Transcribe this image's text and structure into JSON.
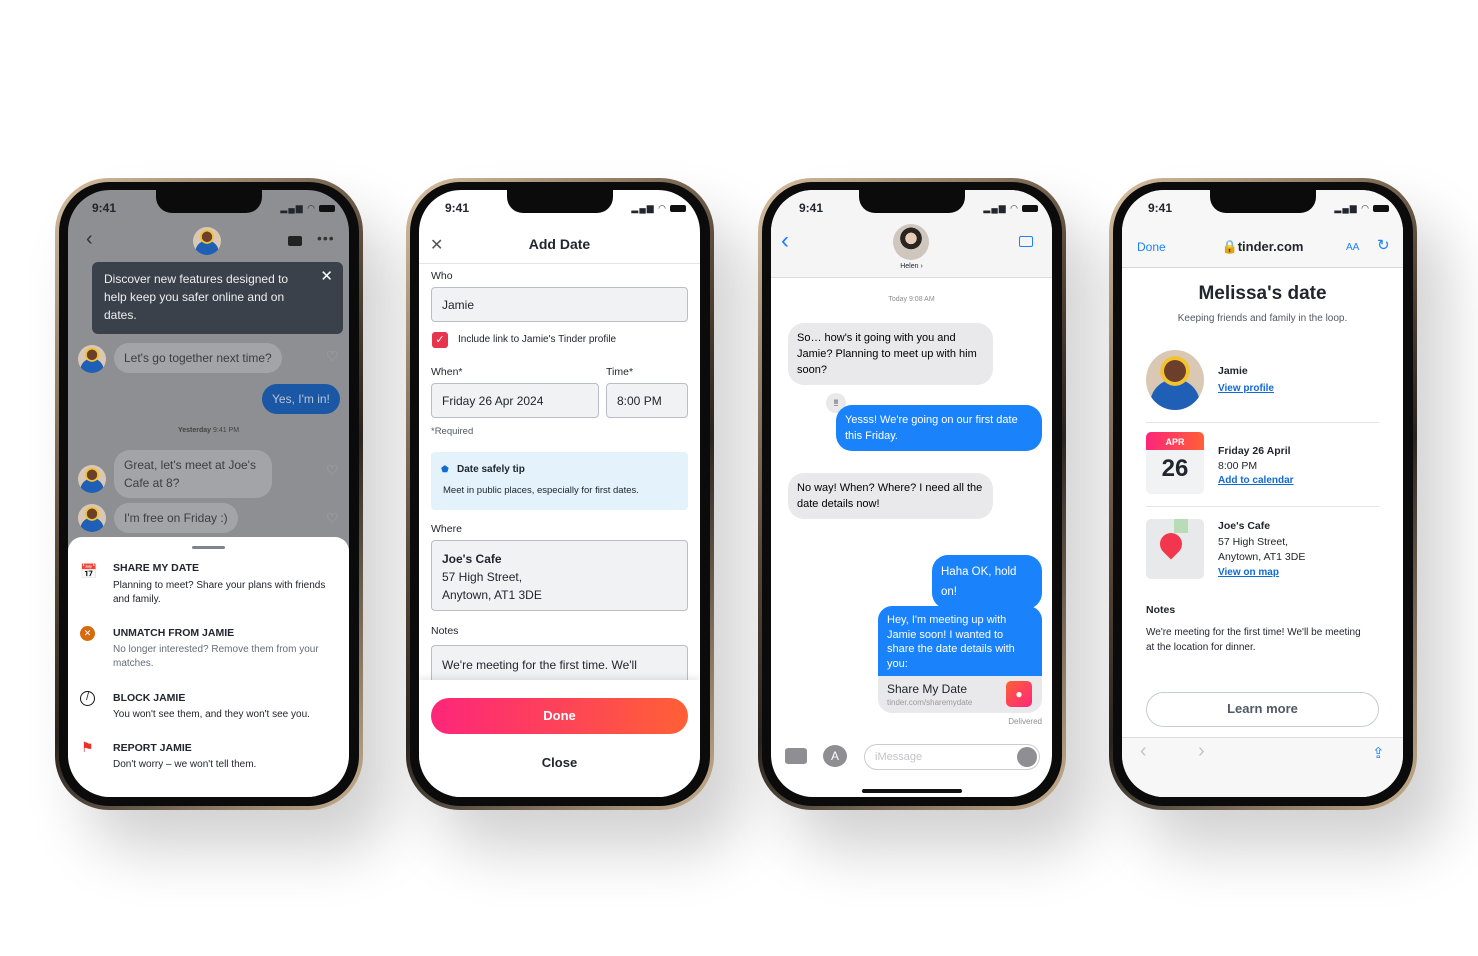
{
  "status_time": "9:41",
  "phone1": {
    "tooltip": "Discover new features designed to help keep you safer online and on dates.",
    "messages": [
      {
        "text": "Let's go together next time?",
        "from": "them"
      },
      {
        "text": "Yes, I'm in!",
        "from": "me"
      },
      {
        "text": "Great, let's meet at Joe's Cafe at 8?",
        "from": "them"
      },
      {
        "text": "I'm free on Friday :)",
        "from": "them"
      }
    ],
    "timestamp_day": "Yesterday",
    "timestamp_time": "9:41 PM",
    "sheet": [
      {
        "title": "SHARE MY DATE",
        "desc": "Planning to meet? Share your plans with friends and family.",
        "icon": "calendar-heart-icon"
      },
      {
        "title": "UNMATCH FROM JAMIE",
        "desc": "No longer interested? Remove them from your matches.",
        "icon": "unmatch-icon"
      },
      {
        "title": "BLOCK JAMIE",
        "desc": "You won't see them, and they won't see you.",
        "icon": "block-icon"
      },
      {
        "title": "REPORT JAMIE",
        "desc": "Don't worry – we won't tell them.",
        "icon": "flag-icon"
      }
    ]
  },
  "phone2": {
    "title": "Add Date",
    "who_label": "Who",
    "who_value": "Jamie",
    "include_link": "Include link to Jamie's Tinder profile",
    "include_checked": true,
    "when_label": "When*",
    "when_value": "Friday 26 Apr 2024",
    "time_label": "Time*",
    "time_value": "8:00 PM",
    "required": "*Required",
    "tip_title": "Date safely tip",
    "tip_text": "Meet in public places, especially for first dates.",
    "where_label": "Where",
    "where_lines": [
      "Joe's Cafe",
      "57 High Street,",
      "Anytown, AT1 3DE"
    ],
    "notes_label": "Notes",
    "notes_value": "We're meeting for the first time. We'll",
    "done": "Done",
    "close": "Close",
    "accent_start": "#fd267a",
    "accent_end": "#ff6036"
  },
  "phone3": {
    "contact": "Helen ›",
    "timestamp": "Today 9:08 AM",
    "messages": [
      "So… how's it going with you and Jamie? Planning to meet up with him soon?",
      "Yesss! We're going on our first date this Friday.",
      "No way! When? Where? I need all the date details now!",
      "Haha OK, hold on!",
      "Hey, I'm meeting up with Jamie soon! I wanted to share the date details with you:"
    ],
    "link_title": "Share My Date",
    "link_url": "tinder.com/sharemydate",
    "delivered": "Delivered",
    "input_placeholder": "iMessage",
    "blue": "#1a82fb"
  },
  "phone4": {
    "done": "Done",
    "url": "tinder.com",
    "aa": "AA",
    "title": "Melissa's date",
    "subtitle": "Keeping friends and family in the loop.",
    "name": "Jamie",
    "view_profile": "View profile",
    "cal_month": "APR",
    "cal_day": "26",
    "date": "Friday 26 April",
    "time": "8:00 PM",
    "add_calendar": "Add to calendar",
    "place": "Joe's Cafe",
    "addr1": "57 High Street,",
    "addr2": "Anytown, AT1 3DE",
    "view_map": "View on map",
    "notes_label": "Notes",
    "notes": "We're meeting for the first time! We'll be meeting at the location for dinner.",
    "learn_more": "Learn more"
  }
}
